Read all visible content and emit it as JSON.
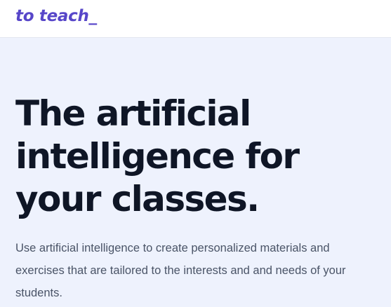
{
  "header": {
    "logo_text": "to teach_"
  },
  "hero": {
    "headline_lines": [
      "The artificial",
      "intelligence for",
      "your classes."
    ],
    "description_lines": [
      "Use artificial intelligence to create personalized materials and",
      "exercises that are tailored to the interests and and needs of your",
      "students."
    ]
  },
  "colors": {
    "brand": "#5746c9",
    "hero_background": "#eef2fd",
    "headline": "#0f1626",
    "body_text": "#4a5467"
  }
}
